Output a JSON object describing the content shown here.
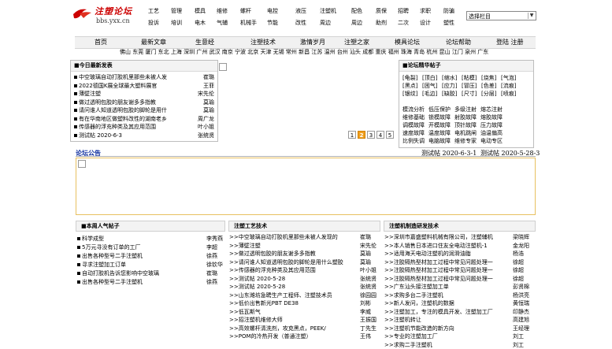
{
  "header": {
    "logo_title": "注塑论坛",
    "logo_url": "bbs.yxx.cn",
    "categories_row1": [
      "工艺",
      "管理",
      "模具",
      "维修",
      "螺杆",
      "电控",
      "液压",
      "注塑机",
      "配色",
      "质保",
      "招聘",
      "求职",
      "防骗"
    ],
    "categories_row2": [
      "投诉",
      "培训",
      "电木",
      "气辅",
      "机械手",
      "节能",
      "改性",
      "周边",
      "周边",
      "助剂",
      "二次",
      "设计",
      "塑性"
    ],
    "select_label": "选择栏目"
  },
  "nav": [
    "首页",
    "最新文章",
    "生意经",
    "注塑技术",
    "激情岁月",
    "注塑之家",
    "模具论坛",
    "论坛帮助",
    "登陆 注册"
  ],
  "cities": "佛山 东莞 厦门 东北 上海 深圳 广州 武汉 南京 宁波 北京 天津 无锡 常州 新昌 江苏 温州 台州 汕头 成都 重庆 福州 珠海 青岛 杭州 昆山 江门 泉州 广东",
  "latest": {
    "title": "■今日最新发表",
    "items": [
      {
        "title": "中空玻璃自动打胶机里那些未被人发",
        "author": "崔璐"
      },
      {
        "title": "2022德国K展全球最大塑料展官",
        "author": "王菲"
      },
      {
        "title": "薄壁注塑",
        "author": "宋先伦"
      },
      {
        "title": "做过透明包胶的朋友谢多多指教",
        "author": "莫瑜"
      },
      {
        "title": "请问谁人知道透明包胶的脚轮是用什",
        "author": "莫瑜"
      },
      {
        "title": "有在华南地区做塑料改性的湖南老乡",
        "author": "周广龙"
      },
      {
        "title": "传感器的浮充种类及其应用范围",
        "author": "叶小姐"
      },
      {
        "title": "测试帖 2020-6-3",
        "author": "张统贤"
      }
    ]
  },
  "pager": [
    "1",
    "2",
    "3",
    "4",
    "5"
  ],
  "pager_active": "2",
  "picks": {
    "title": "■论坛精华帖子",
    "tags": [
      [
        "[龟裂]",
        "[顶白]",
        "[缩水]",
        "[粘模]",
        "[烧焦]",
        "[气泡]"
      ],
      [
        "[黑点]",
        "[困气]",
        "[应力]",
        "[冒压]",
        "[色差]",
        "[流痕]"
      ],
      [
        "[银纹]",
        "[毛边]",
        "[缺胶]",
        "[尺寸]",
        "[分层]",
        "[喷痕]"
      ]
    ],
    "faults": [
      [
        "模流分析",
        "低压保护",
        "多级注射",
        "熔芯注射"
      ],
      [
        "维修基础",
        "锁模故障",
        "射胶故障",
        "熔胶故障"
      ],
      [
        "调模故障",
        "开模故障",
        "顶针故障",
        "压力故障"
      ],
      [
        "速度故障",
        "温度故障",
        "电机跳闸",
        "油温偏高"
      ],
      [
        "比例失调",
        "电脑故障",
        "维修专家",
        "电动专区"
      ]
    ]
  },
  "announcement": {
    "title": "论坛公告",
    "items": [
      "测试帖 2020-6-3-1",
      "测试帖 2020-5-28-3"
    ]
  },
  "hot": {
    "title": "■本周人气帖子",
    "items": [
      {
        "title": "科学成型",
        "author": "李秀燕"
      },
      {
        "title": "5万元寻没有订单的工厂",
        "author": "李超"
      },
      {
        "title": "出售各种型号二手注塑机",
        "author": "徐燕"
      },
      {
        "title": "寻求注塑加工订单",
        "author": "徐钦华"
      },
      {
        "title": "自动打胶机告诉您影响中空玻璃",
        "author": "崔璐"
      },
      {
        "title": "出售各种型号二手注塑机",
        "author": "徐燕"
      }
    ]
  },
  "tech": {
    "title": "注塑工艺技术",
    "items": [
      {
        "title": ">>中空玻璃自动打胶机里那些未被人发现的",
        "author": "崔璐"
      },
      {
        "title": ">>薄壁注塑",
        "author": "宋先伦"
      },
      {
        "title": ">>做过透明包胶的朋友谢多多指教",
        "author": "莫瑜"
      },
      {
        "title": ">>请问谁人知道透明包胶的脚轮是用什么塑胶",
        "author": "莫瑜"
      },
      {
        "title": ">>传感器的浮充种类及其应用范围",
        "author": "叶小姐"
      },
      {
        "title": ">>测试帖 2020-5-28",
        "author": "张统贤"
      },
      {
        "title": ">>测试帖 2020-5-28",
        "author": "张统贤"
      },
      {
        "title": ">>山东潍坊急聘生产工程师、注塑技术员",
        "author": "徐园园"
      },
      {
        "title": ">>低价出售新光PBT DE38",
        "author": "刘彬"
      },
      {
        "title": ">>低瓦斯气",
        "author": "李威"
      },
      {
        "title": ">>招注塑机维修大师",
        "author": "王振国"
      },
      {
        "title": ">>高效螺杆清洗剂，攻克黑点，PEEK/",
        "author": "丁先生"
      },
      {
        "title": ">>POM的冷热开发（普通注塑）",
        "author": "王伟"
      }
    ]
  },
  "machines": {
    "title": "注塑机制造研发技术",
    "items": [
      {
        "title": ">>深圳市嘉盛塑料机械有限公司，注塑辅机",
        "author": "梁晓辉"
      },
      {
        "title": ">>本人销售日本进口住友全电动注塑机-1",
        "author": "金龙阳"
      },
      {
        "title": ">>适用海天电动注塑机的润滑油脂",
        "author": "杨浩"
      },
      {
        "title": ">>注胶隔热型材加工过程中常见问题处理一",
        "author": "徐超"
      },
      {
        "title": ">>注胶隔热型材加工过程中常见问题处理一",
        "author": "徐超"
      },
      {
        "title": ">>注胶隔热型材加工过程中常见问题处理一",
        "author": "徐超"
      },
      {
        "title": ">>广东汕头接注塑加工单",
        "author": "彭贤棉"
      },
      {
        "title": ">>求购多台二手注塑机",
        "author": "杨洪亮"
      },
      {
        "title": ">>新人发问，注塑机的数据",
        "author": "黄恒瑞"
      },
      {
        "title": ">>注塑加工，专注的模具开发、注塑加工厂",
        "author": "印静杰"
      },
      {
        "title": ">>注塑机转让",
        "author": "高建旭"
      },
      {
        "title": ">>注塑机节能改造的新方向",
        "author": "王经理"
      },
      {
        "title": ">>专业的注塑加工厂",
        "author": "刘工"
      },
      {
        "title": ">>求购二手注塑机",
        "author": "刘工"
      }
    ]
  },
  "colors": {
    "logo_red": "#cc0000",
    "link_blue": "#1030a0",
    "pager_active": "#f0a020",
    "banner_border": "#e8c060"
  }
}
